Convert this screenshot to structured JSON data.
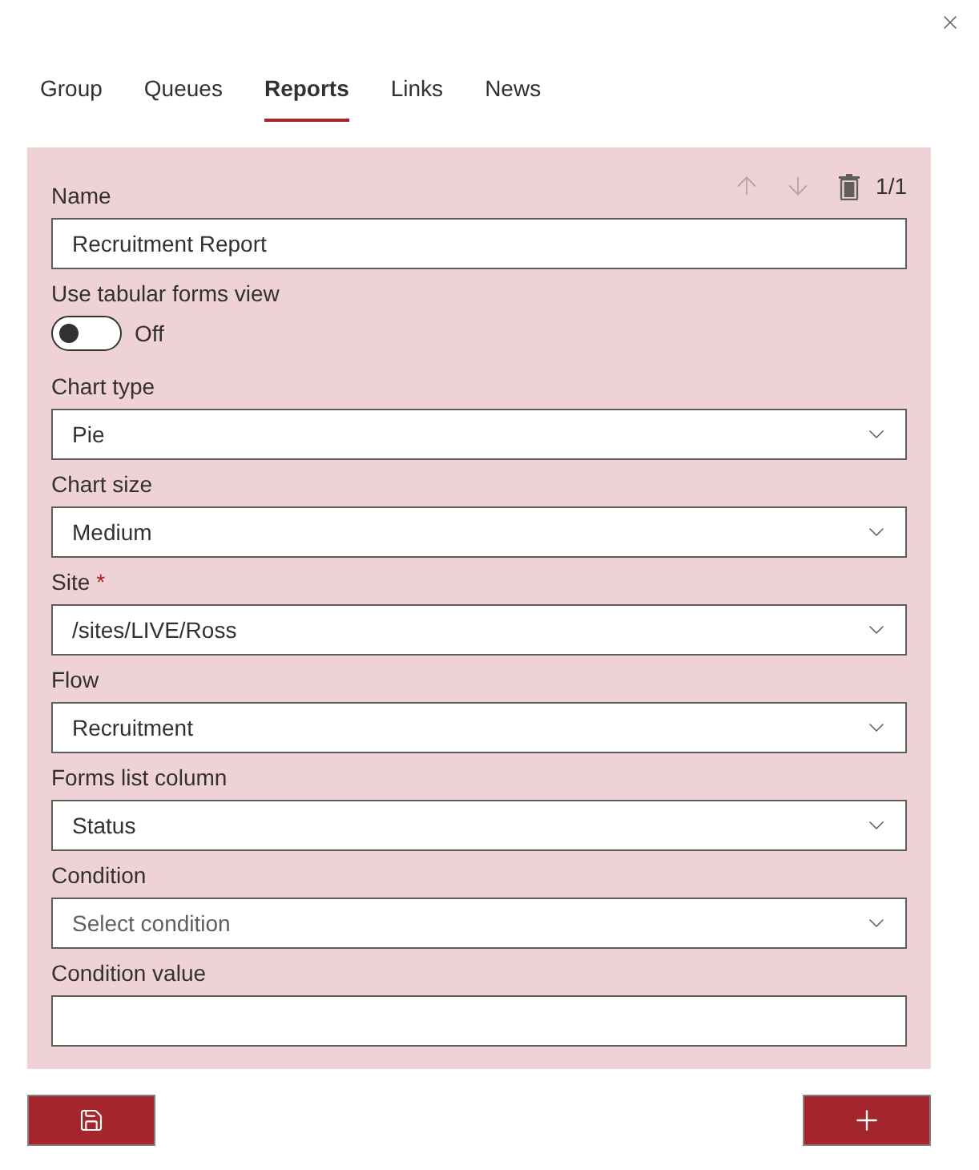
{
  "tabs": [
    {
      "label": "Group",
      "selected": false
    },
    {
      "label": "Queues",
      "selected": false
    },
    {
      "label": "Reports",
      "selected": true
    },
    {
      "label": "Links",
      "selected": false
    },
    {
      "label": "News",
      "selected": false
    }
  ],
  "report_card": {
    "actions": [
      {
        "kind": "move_up",
        "disabled": true
      },
      {
        "kind": "move_down",
        "disabled": true
      },
      {
        "kind": "delete",
        "disabled": false
      }
    ],
    "counter": "1/1",
    "fields": [
      {
        "kind": "text",
        "label": "Name",
        "value": "Recruitment Report"
      },
      {
        "kind": "toggle",
        "label": "Use tabular forms view",
        "on": false,
        "state_text": "Off"
      },
      {
        "kind": "select",
        "label": "Chart type",
        "value": "Pie"
      },
      {
        "kind": "select",
        "label": "Chart size",
        "value": "Medium"
      },
      {
        "kind": "select",
        "label": "Site",
        "required_mark": "*",
        "value": "/sites/LIVE/Ross"
      },
      {
        "kind": "select",
        "label": "Flow",
        "value": "Recruitment"
      },
      {
        "kind": "select",
        "label": "Forms list column",
        "value": "Status"
      },
      {
        "kind": "select",
        "label": "Condition",
        "placeholder": "Select condition"
      },
      {
        "kind": "text",
        "label": "Condition value"
      }
    ]
  },
  "buttons": [
    {
      "kind": "save"
    },
    {
      "kind": "add"
    }
  ]
}
